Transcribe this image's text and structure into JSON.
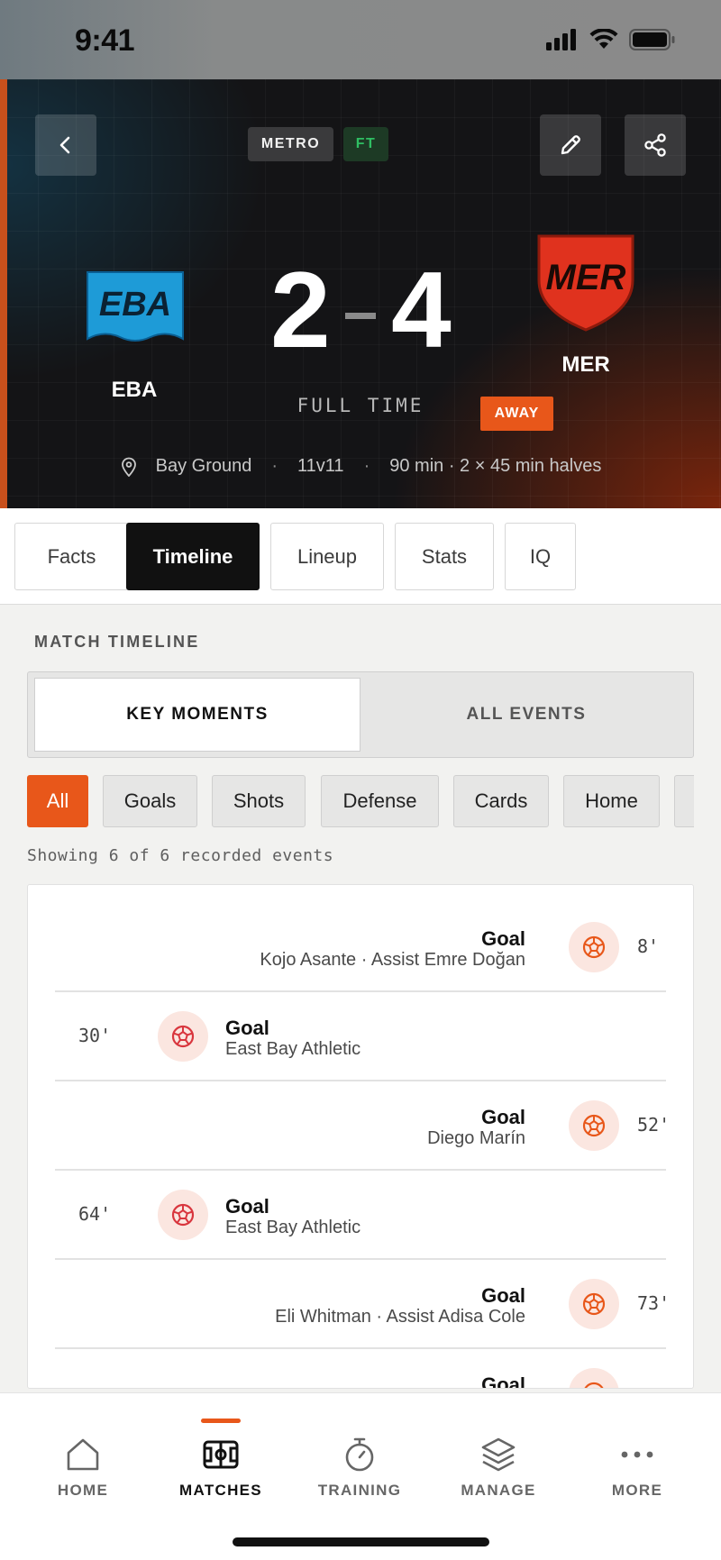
{
  "status_bar": {
    "time": "9:41"
  },
  "match": {
    "league_badge": "METRO",
    "status_badge": "FT",
    "home": {
      "short": "EBA",
      "crest_text": "EBA",
      "crest_color": "#1e9bd7"
    },
    "away": {
      "short": "MER",
      "crest_text": "MER",
      "crest_color": "#e0321e"
    },
    "home_score": "2",
    "away_score": "4",
    "phase": "FULL TIME",
    "side_badge": "AWAY",
    "venue": "Bay Ground",
    "format": "11v11",
    "duration": "90 min · 2 × 45 min halves"
  },
  "tabs": [
    "Facts",
    "Timeline",
    "Lineup",
    "Stats",
    "IQ"
  ],
  "active_tab": "Timeline",
  "timeline": {
    "section_label": "MATCH TIMELINE",
    "modes": [
      "KEY MOMENTS",
      "ALL EVENTS"
    ],
    "active_mode": "KEY MOMENTS",
    "filters": [
      "All",
      "Goals",
      "Shots",
      "Defense",
      "Cards",
      "Home"
    ],
    "active_filter": "All",
    "showing": "Showing 6 of 6 recorded events",
    "events": [
      {
        "side": "right",
        "minute": "8'",
        "title": "Goal",
        "detail": "Kojo Asante · Assist Emre Doğan"
      },
      {
        "side": "left",
        "minute": "30'",
        "title": "Goal",
        "detail": "East Bay Athletic"
      },
      {
        "side": "right",
        "minute": "52'",
        "title": "Goal",
        "detail": "Diego Marín"
      },
      {
        "side": "left",
        "minute": "64'",
        "title": "Goal",
        "detail": "East Bay Athletic"
      },
      {
        "side": "right",
        "minute": "73'",
        "title": "Goal",
        "detail": "Eli Whitman · Assist Adisa Cole"
      },
      {
        "side": "right",
        "minute": "",
        "title": "Goal",
        "detail": ""
      }
    ]
  },
  "bottom_nav": {
    "items": [
      {
        "label": "HOME",
        "icon": "home-icon"
      },
      {
        "label": "MATCHES",
        "icon": "pitch-icon"
      },
      {
        "label": "TRAINING",
        "icon": "stopwatch-icon"
      },
      {
        "label": "MANAGE",
        "icon": "layers-icon"
      },
      {
        "label": "MORE",
        "icon": "more-dots-icon"
      }
    ],
    "active": "MATCHES"
  },
  "colors": {
    "accent": "#e8571a",
    "home_event_icon": "#d9363e",
    "away_event_icon": "#e8571a"
  }
}
